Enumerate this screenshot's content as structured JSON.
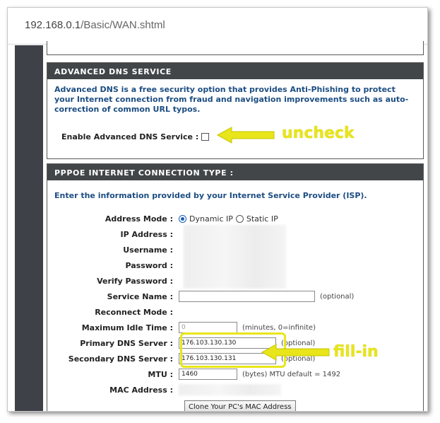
{
  "browser": {
    "url_host": "192.168.0.1",
    "url_path": "/Basic/WAN.shtml"
  },
  "advanced_dns": {
    "header": "ADVANCED DNS SERVICE",
    "description": "Advanced DNS is a free security option that provides Anti-Phishing to protect your Internet connection from fraud and navigation improvements such as auto-correction of common URL typos.",
    "enable_label": "Enable Advanced DNS Service :",
    "enabled": false
  },
  "pppoe": {
    "header": "PPPOE INTERNET CONNECTION TYPE :",
    "intro": "Enter the information provided by your Internet Service Provider (ISP).",
    "address_mode_label": "Address Mode :",
    "dynamic_ip_label": "Dynamic IP",
    "static_ip_label": "Static IP",
    "selected_mode": "Dynamic IP",
    "ip_address_label": "IP Address :",
    "username_label": "Username :",
    "password_label": "Password :",
    "verify_password_label": "Verify Password :",
    "service_name_label": "Service Name :",
    "service_name_value": "",
    "optional": "(optional)",
    "reconnect_mode_label": "Reconnect Mode :",
    "max_idle_label": "Maximum Idle Time :",
    "max_idle_value": "0",
    "max_idle_note": "(minutes, 0=infinite)",
    "primary_dns_label": "Primary DNS Server :",
    "primary_dns_value": "176.103.130.130",
    "secondary_dns_label": "Secondary DNS Server :",
    "secondary_dns_value": "176.103.130.131",
    "mtu_label": "MTU :",
    "mtu_value": "1460",
    "mtu_note": "(bytes) MTU default = 1492",
    "mac_address_label": "MAC Address :",
    "clone_button": "Clone Your PC's MAC Address"
  },
  "annotations": {
    "uncheck": "uncheck",
    "fill_in": "fill-in",
    "color": "#e8e51a"
  }
}
